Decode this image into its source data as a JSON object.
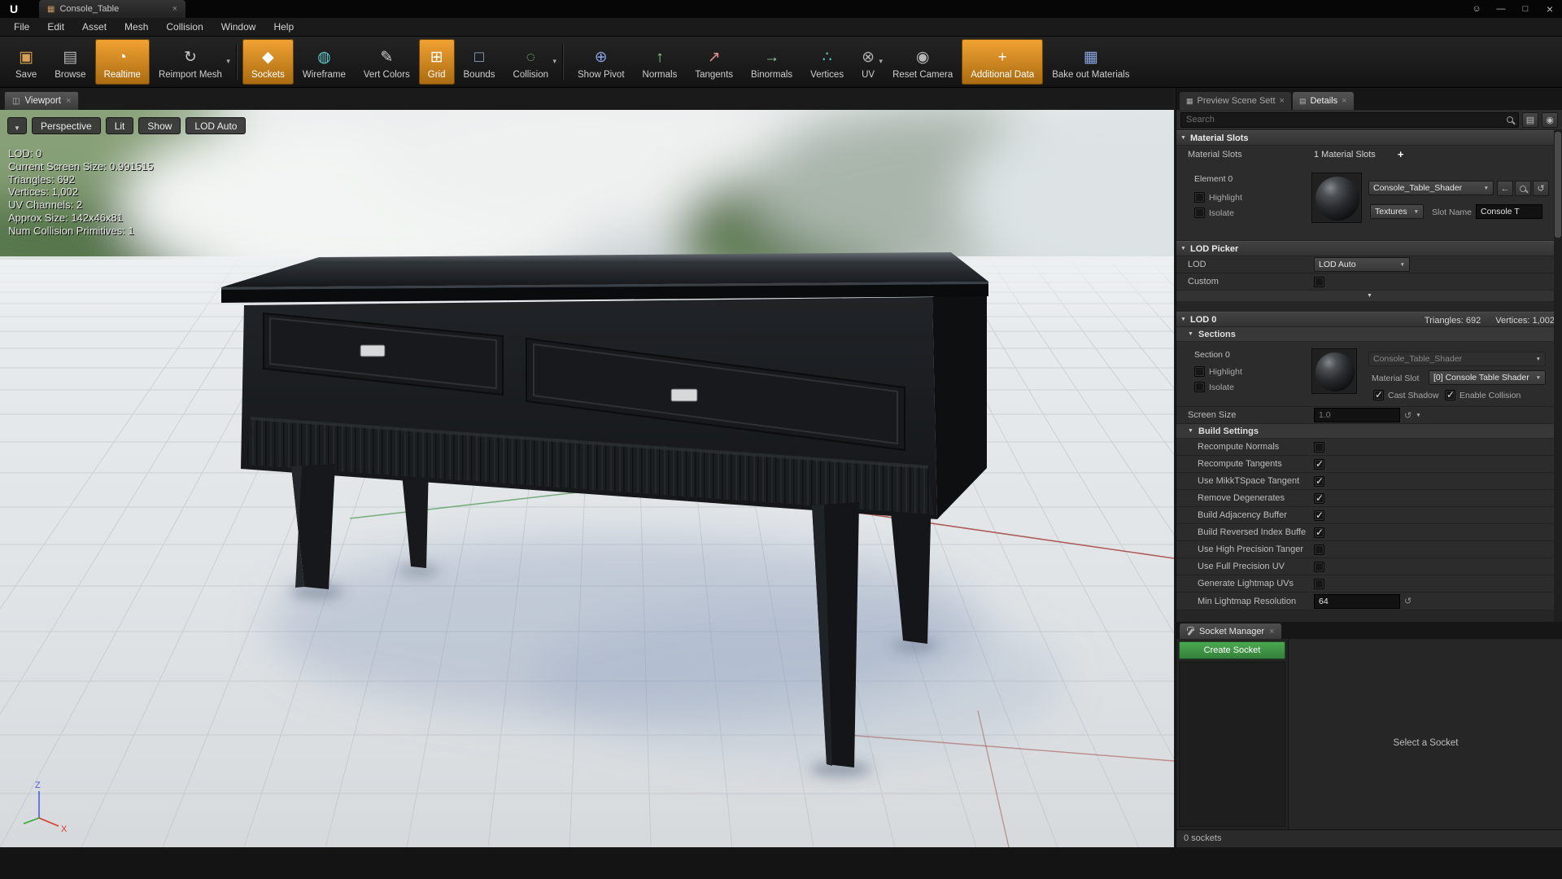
{
  "icons": {
    "logo": "U",
    "asset": "▦",
    "close": "×",
    "minimize": "—",
    "maximize": "□",
    "feedback": "☺",
    "viewport": "◫",
    "preview_tab": "▦",
    "details_tab": "▤",
    "caret": "▼",
    "expander": "▼",
    "plus": "+",
    "back": "←",
    "reset": "↺",
    "list": "▤",
    "eye": "◉"
  },
  "window": {
    "tab_title": "Console_Table",
    "menu_items": [
      "File",
      "Edit",
      "Asset",
      "Mesh",
      "Collision",
      "Window",
      "Help"
    ]
  },
  "toolbar": {
    "groups": [
      [
        {
          "name": "save-button",
          "label": "Save",
          "glyph": "▣",
          "glyph_color": "#d8a050"
        },
        {
          "name": "browse-button",
          "label": "Browse",
          "glyph": "▤",
          "glyph_color": "#b8b8b8"
        },
        {
          "name": "realtime-toggle",
          "label": "Realtime",
          "glyph": "◔",
          "glyph_color": "#ffffff",
          "active": true
        },
        {
          "name": "reimport-mesh-button",
          "label": "Reimport Mesh",
          "glyph": "↻",
          "glyph_color": "#c8c8c8",
          "dropdown": true
        }
      ],
      [
        {
          "name": "sockets-toggle",
          "label": "Sockets",
          "glyph": "◆",
          "glyph_color": "#ffffff",
          "active": true
        },
        {
          "name": "wireframe-toggle",
          "label": "Wireframe",
          "glyph": "◍",
          "glyph_color": "#5bc8c8"
        },
        {
          "name": "vert-colors-toggle",
          "label": "Vert Colors",
          "glyph": "✎",
          "glyph_color": "#d0d0d0"
        },
        {
          "name": "grid-toggle",
          "label": "Grid",
          "glyph": "⊞",
          "glyph_color": "#ffffff",
          "active": true
        },
        {
          "name": "bounds-toggle",
          "label": "Bounds",
          "glyph": "□",
          "glyph_color": "#9ab8d8"
        },
        {
          "name": "collision-toggle",
          "label": "Collision",
          "glyph": "◌",
          "glyph_color": "#80c880",
          "dropdown": true
        }
      ],
      [
        {
          "name": "show-pivot-toggle",
          "label": "Show Pivot",
          "glyph": "⊕",
          "glyph_color": "#88a0e0"
        },
        {
          "name": "normals-toggle",
          "label": "Normals",
          "glyph": "↑",
          "glyph_color": "#90d890"
        },
        {
          "name": "tangents-toggle",
          "label": "Tangents",
          "glyph": "↗",
          "glyph_color": "#e09090"
        },
        {
          "name": "binormals-toggle",
          "label": "Binormals",
          "glyph": "→",
          "glyph_color": "#90d890"
        },
        {
          "name": "vertices-toggle",
          "label": "Vertices",
          "glyph": "∴",
          "glyph_color": "#58c8c8"
        },
        {
          "name": "uv-toggle",
          "label": "UV",
          "glyph": "⊗",
          "glyph_color": "#b0b0b0",
          "dropdown": true
        },
        {
          "name": "reset-camera-button",
          "label": "Reset Camera",
          "glyph": "◉",
          "glyph_color": "#b8b8b8"
        },
        {
          "name": "additional-data-toggle",
          "label": "Additional Data",
          "glyph": "+",
          "glyph_color": "#ffffff",
          "active": true
        },
        {
          "name": "bake-materials-button",
          "label": "Bake out Materials",
          "glyph": "▦",
          "glyph_color": "#88a8e0"
        }
      ]
    ]
  },
  "viewport": {
    "tab": "Viewport",
    "toolbar": [
      "Perspective",
      "Lit",
      "Show",
      "LOD Auto"
    ],
    "stats": [
      "LOD:  0",
      "Current Screen Size:  0.991515",
      "Triangles:  692",
      "Vertices:  1,002",
      "UV Channels:  2",
      "Approx Size:  142x46x81",
      "Num Collision Primitives:  1"
    ],
    "gizmo": {
      "x": "X",
      "z": "Z"
    }
  },
  "details": {
    "tabs": {
      "preview": "Preview Scene Sett",
      "details": "Details"
    },
    "search_placeholder": "Search",
    "material_slots": {
      "header": "Material Slots",
      "label": "Material Slots",
      "count": "1 Material Slots",
      "element": "Element 0",
      "highlight": "Highlight",
      "highlight_checked": false,
      "isolate": "Isolate",
      "isolate_checked": false,
      "shader": "Console_Table_Shader",
      "textures": "Textures",
      "slot_name_label": "Slot Name",
      "slot_name_value": "Console T"
    },
    "lod_picker": {
      "header": "LOD Picker",
      "lod_label": "LOD",
      "lod_value": "LOD Auto",
      "custom_label": "Custom",
      "custom_checked": false
    },
    "lod0": {
      "header": "LOD 0",
      "triangles": "Triangles: 692",
      "vertices": "Vertices: 1,002",
      "sections_header": "Sections",
      "section": "Section 0",
      "highlight": "Highlight",
      "highlight_checked": false,
      "isolate": "Isolate",
      "isolate_checked": false,
      "shader": "Console_Table_Shader",
      "material_slot_label": "Material Slot",
      "material_slot_value": "[0] Console Table Shader",
      "cast_shadow": "Cast Shadow",
      "cast_shadow_checked": true,
      "enable_collision": "Enable Collision",
      "enable_collision_checked": true,
      "screen_size_label": "Screen Size",
      "screen_size_value": "1.0"
    },
    "build_settings": {
      "header": "Build Settings",
      "rows": [
        {
          "label": "Recompute Normals",
          "checked": false
        },
        {
          "label": "Recompute Tangents",
          "checked": true
        },
        {
          "label": "Use MikkTSpace Tangent",
          "checked": true
        },
        {
          "label": "Remove Degenerates",
          "checked": true
        },
        {
          "label": "Build Adjacency Buffer",
          "checked": true
        },
        {
          "label": "Build Reversed Index Buffe",
          "checked": true
        },
        {
          "label": "Use High Precision Tanger",
          "checked": false
        },
        {
          "label": "Use Full Precision UV",
          "checked": false
        },
        {
          "label": "Generate Lightmap UVs",
          "checked": false
        }
      ],
      "min_lightmap_label": "Min Lightmap Resolution",
      "min_lightmap_value": "64"
    }
  },
  "socket_manager": {
    "tab": "Socket Manager",
    "create": "Create Socket",
    "empty": "Select a Socket",
    "status": "0 sockets"
  }
}
